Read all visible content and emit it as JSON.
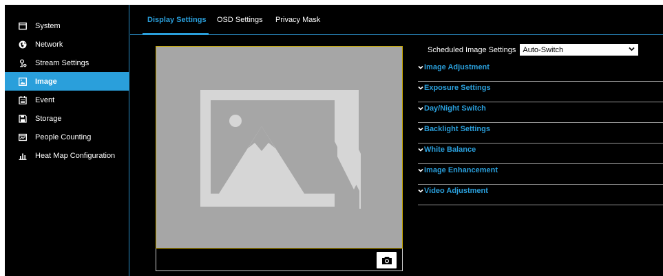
{
  "sidebar": {
    "items": [
      {
        "label": "System",
        "icon": "monitor-icon",
        "active": false
      },
      {
        "label": "Network",
        "icon": "globe-icon",
        "active": false
      },
      {
        "label": "Stream Settings",
        "icon": "stream-settings-icon",
        "active": false
      },
      {
        "label": "Image",
        "icon": "image-icon",
        "active": true
      },
      {
        "label": "Event",
        "icon": "calendar-list-icon",
        "active": false
      },
      {
        "label": "Storage",
        "icon": "floppy-disk-icon",
        "active": false
      },
      {
        "label": "People Counting",
        "icon": "people-counting-icon",
        "active": false
      },
      {
        "label": "Heat Map Configuration",
        "icon": "bar-chart-icon",
        "active": false
      }
    ]
  },
  "tabs": [
    {
      "label": "Display Settings",
      "active": true
    },
    {
      "label": "OSD Settings",
      "active": false
    },
    {
      "label": "Privacy Mask",
      "active": false
    }
  ],
  "preview": {
    "placeholder_icon": "image-placeholder-icon",
    "snapshot_icon": "camera-icon"
  },
  "schedule": {
    "label": "Scheduled Image Settings",
    "value": "Auto-Switch"
  },
  "sections": [
    {
      "label": "Image Adjustment"
    },
    {
      "label": "Exposure Settings"
    },
    {
      "label": "Day/Night Switch"
    },
    {
      "label": "Backlight Settings"
    },
    {
      "label": "White Balance"
    },
    {
      "label": "Image Enhancement"
    },
    {
      "label": "Video Adjustment"
    }
  ],
  "colors": {
    "accent": "#2a9fdb",
    "background": "#000000",
    "preview_bg": "#a6a6a6",
    "preview_border": "#c8a800"
  }
}
